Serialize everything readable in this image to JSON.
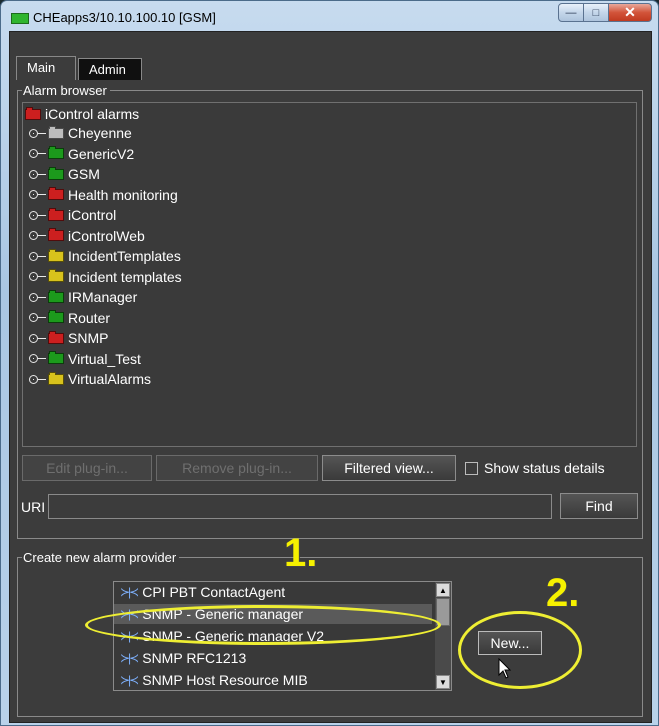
{
  "window": {
    "title": "CHEapps3/10.10.100.10 [GSM]",
    "caption_buttons": {
      "minimize": "—",
      "maximize": "□",
      "close": "✕"
    }
  },
  "tabs": [
    {
      "label": "Main"
    },
    {
      "label": "Admin"
    }
  ],
  "alarm_browser": {
    "title": "Alarm browser",
    "root": {
      "label": "iControl alarms",
      "color": "#cc1f1f"
    },
    "items": [
      {
        "label": "Cheyenne",
        "color": "#bdbdbd"
      },
      {
        "label": "GenericV2",
        "color": "#1c9a1c"
      },
      {
        "label": "GSM",
        "color": "#1c9a1c"
      },
      {
        "label": "Health monitoring",
        "color": "#cc1f1f"
      },
      {
        "label": "iControl",
        "color": "#cc1f1f"
      },
      {
        "label": "iControlWeb",
        "color": "#cc1f1f"
      },
      {
        "label": "IncidentTemplates",
        "color": "#d8c21c"
      },
      {
        "label": "Incident templates",
        "color": "#d8c21c"
      },
      {
        "label": "IRManager",
        "color": "#1c9a1c"
      },
      {
        "label": "Router",
        "color": "#1c9a1c"
      },
      {
        "label": "SNMP",
        "color": "#cc1f1f"
      },
      {
        "label": "Virtual_Test",
        "color": "#1c9a1c"
      },
      {
        "label": "VirtualAlarms",
        "color": "#d8c21c"
      }
    ],
    "buttons": {
      "edit_plugin": "Edit plug-in...",
      "remove_plugin": "Remove plug-in...",
      "filtered_view": "Filtered view..."
    },
    "show_status_details": {
      "label": "Show status details",
      "checked": false
    },
    "uri": {
      "label": "URI",
      "value": "",
      "find_label": "Find"
    }
  },
  "create_provider": {
    "title": "Create new alarm provider",
    "items": [
      {
        "label": "CPI PBT ContactAgent"
      },
      {
        "label": "SNMP - Generic manager"
      },
      {
        "label": "SNMP - Generic manager V2"
      },
      {
        "label": "SNMP RFC1213"
      },
      {
        "label": "SNMP Host Resource MIB"
      }
    ],
    "selected_label": "SNMP - Generic manager",
    "new_label": "New..."
  },
  "annotations": {
    "step1": "1.",
    "step2": "2.",
    "color": "#f6f100"
  }
}
